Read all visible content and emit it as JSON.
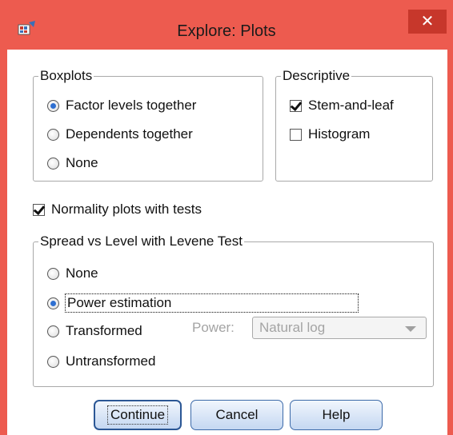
{
  "window": {
    "title": "Explore: Plots",
    "close_glyph": "✕"
  },
  "boxplots": {
    "legend": "Boxplots",
    "options": [
      {
        "label": "Factor levels together",
        "selected": true
      },
      {
        "label": "Dependents together",
        "selected": false
      },
      {
        "label": "None",
        "selected": false
      }
    ]
  },
  "descriptive": {
    "legend": "Descriptive",
    "options": [
      {
        "label": "Stem-and-leaf",
        "checked": true
      },
      {
        "label": "Histogram",
        "checked": false
      }
    ]
  },
  "normality": {
    "label": "Normality plots with tests",
    "checked": true
  },
  "spread": {
    "legend": "Spread vs Level with Levene Test",
    "options": [
      {
        "label": "None",
        "selected": false
      },
      {
        "label": "Power estimation",
        "selected": true
      },
      {
        "label": "Transformed",
        "selected": false
      },
      {
        "label": "Untransformed",
        "selected": false
      }
    ],
    "power_label": "Power:",
    "power_value": "Natural log"
  },
  "buttons": {
    "continue": "Continue",
    "cancel": "Cancel",
    "help": "Help"
  },
  "colors": {
    "titlebar": "#ed5b4f",
    "close_button": "#c7372b",
    "radio_dot": "#2e6fd1"
  }
}
